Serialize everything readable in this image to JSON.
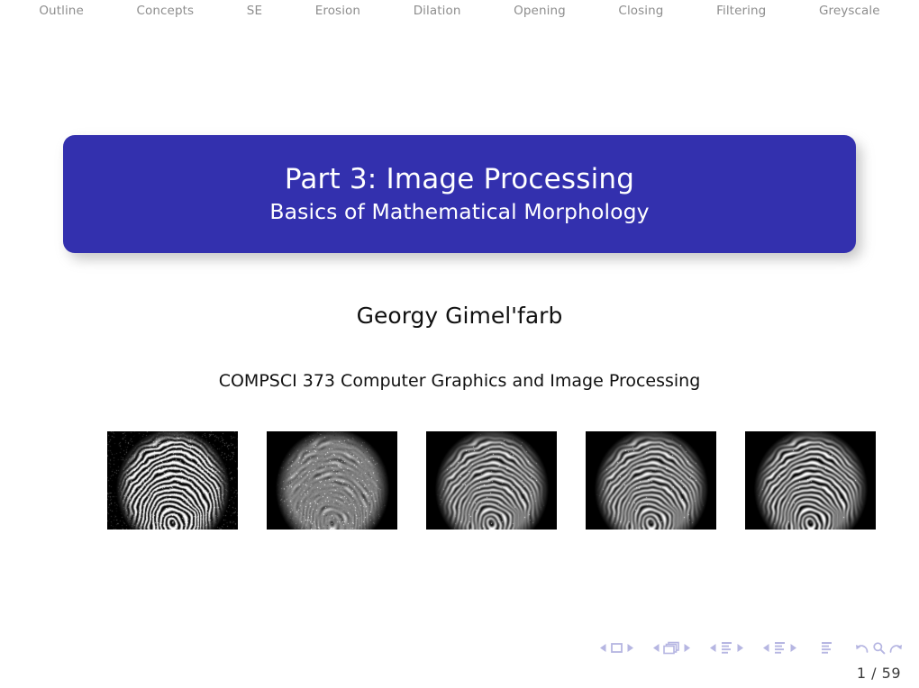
{
  "nav": {
    "items": [
      {
        "label": "Outline"
      },
      {
        "label": "Concepts"
      },
      {
        "label": "SE"
      },
      {
        "label": "Erosion"
      },
      {
        "label": "Dilation"
      },
      {
        "label": "Opening"
      },
      {
        "label": "Closing"
      },
      {
        "label": "Filtering"
      },
      {
        "label": "Greyscale"
      }
    ],
    "color": "#8d8d8d"
  },
  "title": {
    "main": "Part 3: Image Processing",
    "subtitle": "Basics of Mathematical Morphology",
    "background_color": "#3330ae",
    "text_color": "#ffffff"
  },
  "author": "Georgy Gimel'farb",
  "course": "COMPSCI 373 Computer Graphics and Image Processing",
  "figures": {
    "caption": "",
    "images": [
      {
        "name": "fingerprint-original",
        "seed": 11,
        "blur": 0.0,
        "noise": 0.38,
        "gain": 1.0
      },
      {
        "name": "fingerprint-eroded",
        "seed": 11,
        "blur": 1.25,
        "noise": 0.16,
        "gain": 0.8
      },
      {
        "name": "fingerprint-opened",
        "seed": 11,
        "blur": 0.85,
        "noise": 0.05,
        "gain": 0.88
      },
      {
        "name": "fingerprint-closed",
        "seed": 11,
        "blur": 0.8,
        "noise": 0.04,
        "gain": 0.9
      },
      {
        "name": "fingerprint-filtered",
        "seed": 11,
        "blur": 0.35,
        "noise": 0.02,
        "gain": 1.05
      }
    ]
  },
  "footer": {
    "page_current": "1",
    "page_total": "59",
    "page_label": "1 / 59",
    "symbol_color": "#b6b6e2",
    "symbols": [
      {
        "name": "prev-frame-icon"
      },
      {
        "name": "frame-icon"
      },
      {
        "name": "next-frame-icon"
      },
      {
        "name": "prev-subsection-icon"
      },
      {
        "name": "subsection-icon"
      },
      {
        "name": "next-subsection-icon"
      },
      {
        "name": "prev-section-icon"
      },
      {
        "name": "section-icon"
      },
      {
        "name": "next-section-icon"
      },
      {
        "name": "prev-presentation-icon"
      },
      {
        "name": "presentation-icon"
      },
      {
        "name": "next-presentation-icon"
      },
      {
        "name": "doc-icon"
      },
      {
        "name": "back-icon"
      },
      {
        "name": "search-icon"
      },
      {
        "name": "forward-icon"
      }
    ]
  }
}
